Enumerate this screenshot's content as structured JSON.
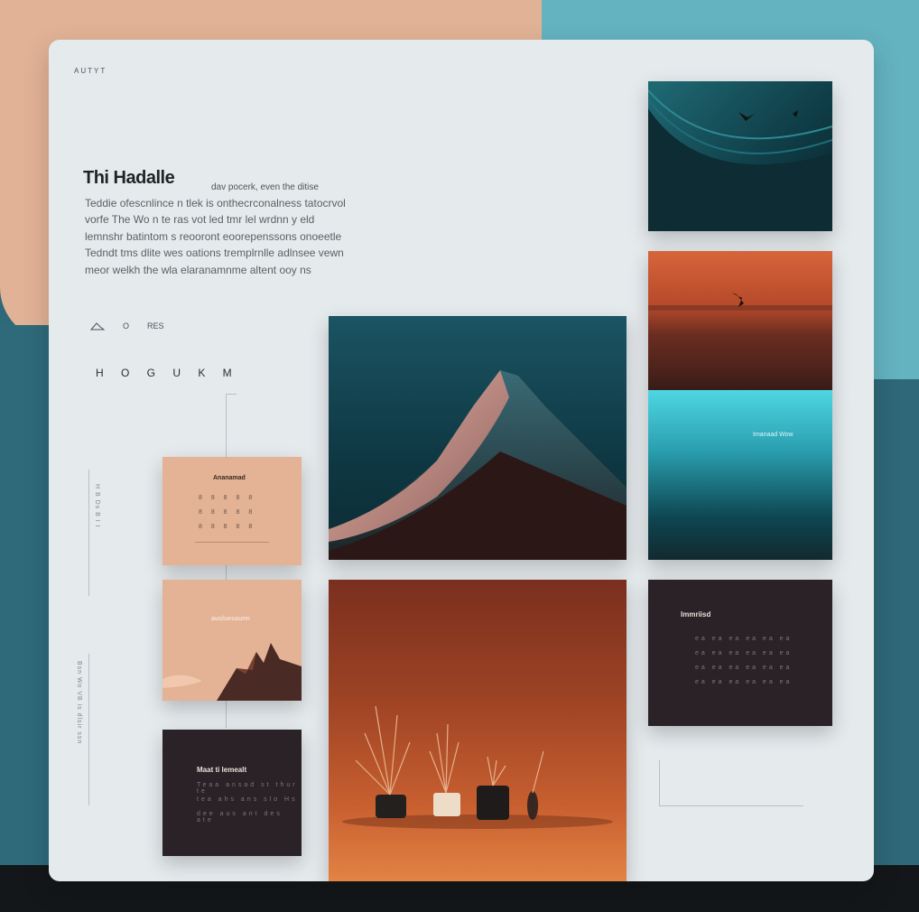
{
  "header": {
    "tag": "AUTYT",
    "title": "Thi Hadalle",
    "subtitle": "dav pocerk, even the ditise",
    "paragraph": "Teddie ofescnlince n tlek is onthecrconalness tatocrvol\nvorfe The Wo n te ras vot led tmr lel wrdnn y eld\nlemnshr batintom s reooront eoorepenssons onoeetle\nTedndt tms dlite wes oations tremplrnlle adlnsee vewn\nmeor welkh the wla elaranamnme altent ooy ns"
  },
  "meta": {
    "icon": "mountain-icon",
    "count": "O",
    "label": "RES"
  },
  "nav": {
    "label": "H O G U K M"
  },
  "sidebar_left": {
    "vertical_text": "Bsn  Wo  VB  is  dlsir  ssn"
  },
  "sidebar_small": {
    "vertical_text": "H  B  Ds  B  I  I"
  },
  "cards": {
    "peach_calendar": {
      "label": "Ananamad",
      "rows": [
        "8 8 8 8 8",
        "8 8 8 8 8",
        "8 8 8 8 8"
      ]
    },
    "peach_mountain": {
      "label": "ausluesaunn"
    },
    "dark_note": {
      "label": "Maat ti Iemealt",
      "lines": [
        "Teaa ansad st thur te",
        "tea ahs ans slo Hs",
        "dee aus ant des ate"
      ]
    },
    "dark_right": {
      "label": "Immriisd",
      "lines": [
        "ea ea ea ea ea ea",
        "ea ea ea ea ea ea",
        "ea ea ea ea ea ea",
        "ea ea ea ea ea ea"
      ]
    },
    "cyan_panel": {
      "label": "Imanaad Wow"
    }
  },
  "colors": {
    "peach": "#e2b296",
    "teal": "#2f6878",
    "cyan": "#64b3c1",
    "dark": "#2a2226",
    "rust": "#b0492a"
  }
}
